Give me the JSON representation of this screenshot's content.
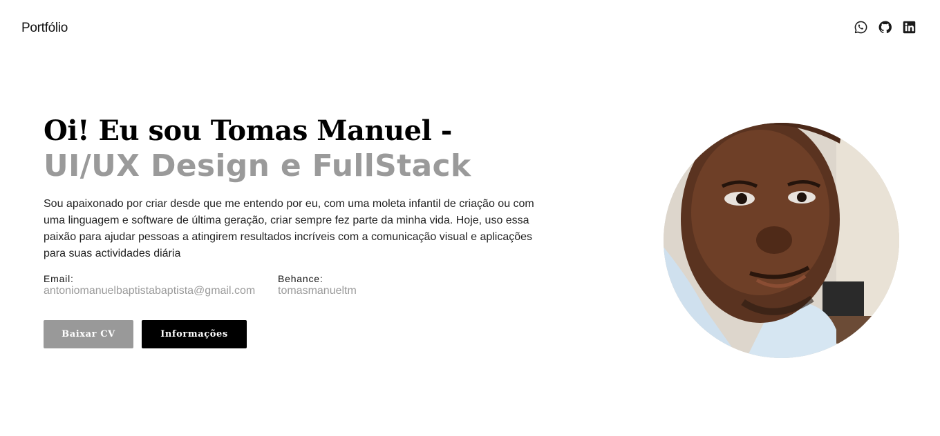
{
  "header": {
    "brand": "Portfólio",
    "social": [
      {
        "icon": "whatsapp-icon"
      },
      {
        "icon": "github-icon"
      },
      {
        "icon": "linkedin-icon"
      }
    ]
  },
  "hero": {
    "headline": "Oi! Eu sou Tomas Manuel -",
    "subheadline": "UI/UX Design e FullStack",
    "about": "Sou apaixonado por criar desde que me entendo por eu, com uma moleta infantil de criação ou com uma linguagem e software de última geração, criar sempre fez parte da minha vida. Hoje, uso essa paixão para ajudar pessoas a atingirem resultados incríveis com a comunicação visual e aplicações para suas actividades diária",
    "email_label": "Email:",
    "email_value": "antoniomanuelbaptistabaptista@gmail.com",
    "behance_label": "Behance:",
    "behance_value": "tomasmanueltm",
    "button_cv": "Baixar CV",
    "button_info": "Informações"
  },
  "colors": {
    "muted": "#9a9a9a",
    "button_primary": "#000000",
    "button_secondary": "#999999"
  }
}
